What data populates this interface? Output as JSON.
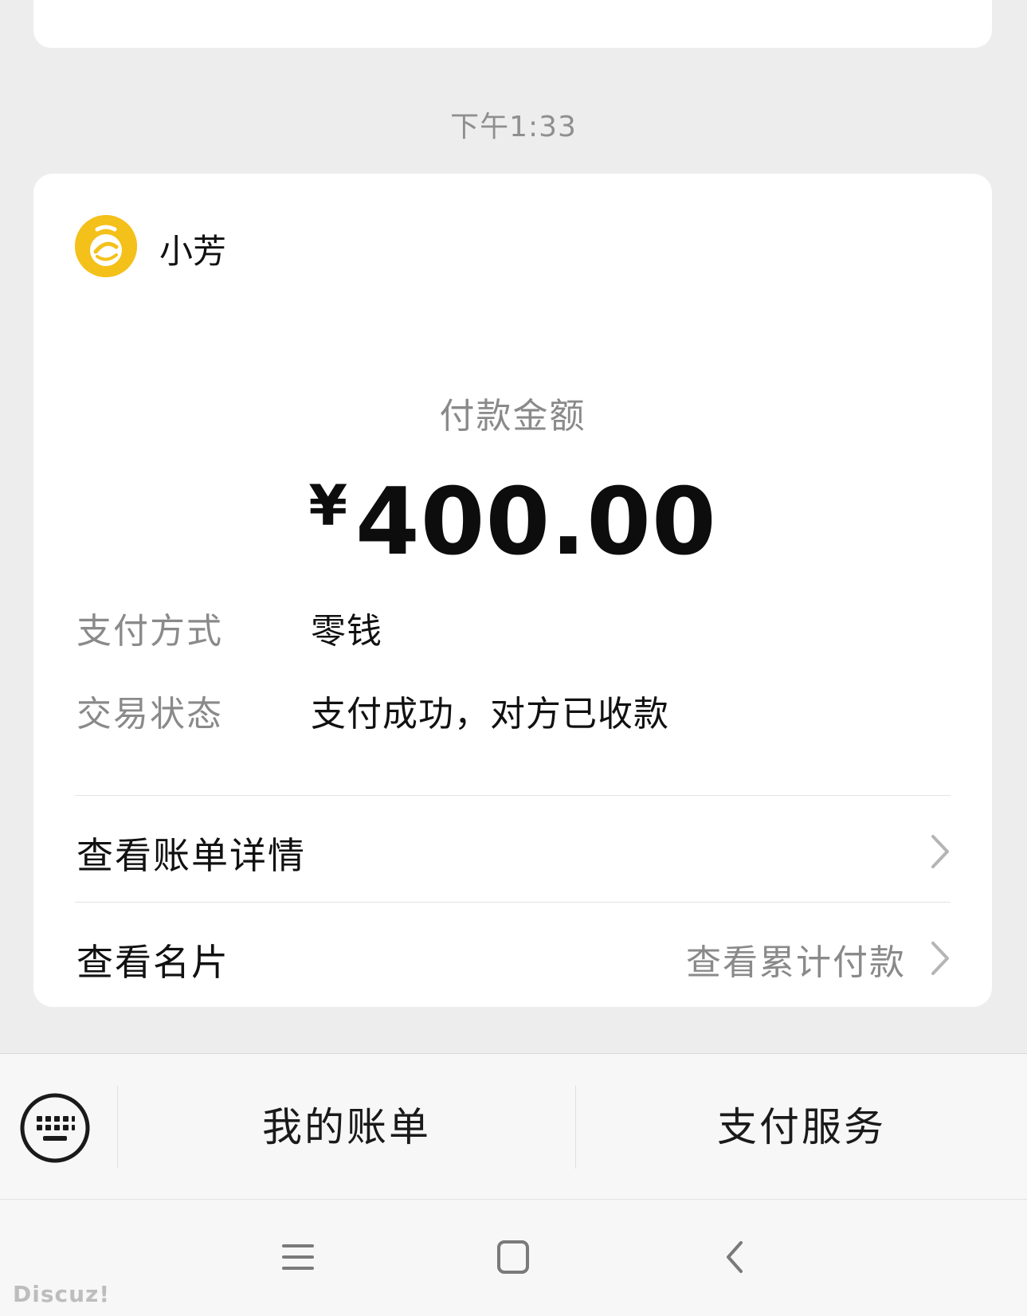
{
  "timestamp": "下午1:33",
  "merchant": {
    "name": "小芳",
    "logo_icon": "merchant-logo-icon",
    "logo_color": "#f4c01a"
  },
  "payment": {
    "amount_label": "付款金额",
    "currency": "¥",
    "amount": "400.00",
    "method_label": "支付方式",
    "method_value": "零钱",
    "status_label": "交易状态",
    "status_value": "支付成功，对方已收款"
  },
  "links": {
    "bill_detail": "查看账单详情",
    "view_card": "查看名片",
    "cumulative": "查看累计付款"
  },
  "bottom_menu": {
    "keyboard_icon": "keyboard-icon",
    "my_bill": "我的账单",
    "pay_service": "支付服务"
  },
  "nav": {
    "menu_icon": "menu-icon",
    "home_icon": "home-icon",
    "back_icon": "back-icon"
  },
  "watermark": "Discuz!"
}
